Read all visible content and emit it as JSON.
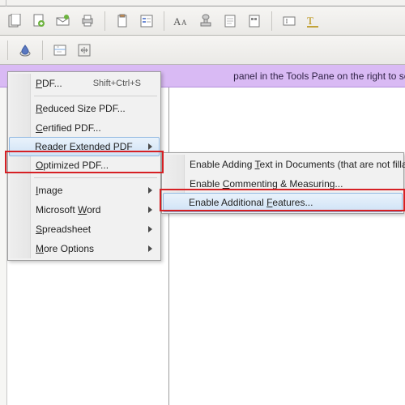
{
  "toolbar_row1_icons": [
    "pages-icon",
    "page-add-icon",
    "mail-pdf-icon",
    "print-icon",
    "clipboard-icon",
    "forms-icon",
    "text-size-icon",
    "stamp-icon",
    "pageview-icon",
    "highlight-block-icon",
    "text-field-icon",
    "typewriter-icon"
  ],
  "toolbar_row2_icons": [
    "ink-icon",
    "scan-icon",
    "fit-icon"
  ],
  "infobar": {
    "text": " panel in the Tools Pane on the right to send it to your recipients."
  },
  "menu": {
    "items": [
      {
        "label_html": "<u>P</u>DF...",
        "shortcut": "Shift+Ctrl+S",
        "arrow": false
      },
      "sep",
      {
        "label_html": "<u>R</u>educed Size PDF...",
        "arrow": false
      },
      {
        "label_html": "<u>C</u>ertified PDF...",
        "arrow": false
      },
      {
        "label_html": "Reader E<u>x</u>tended PDF",
        "arrow": true,
        "highlight": true
      },
      {
        "label_html": "<u>O</u>ptimized PDF...",
        "arrow": false
      },
      "sep",
      {
        "label_html": "<u>I</u>mage",
        "arrow": true
      },
      {
        "label_html": "Microsoft <u>W</u>ord",
        "arrow": true
      },
      {
        "label_html": "<u>S</u>preadsheet",
        "arrow": true
      },
      {
        "label_html": "<u>M</u>ore Options",
        "arrow": true
      }
    ]
  },
  "submenu": {
    "items": [
      {
        "label_html": "Enable Adding <u>T</u>ext in Documents (that are not fillable forms)..."
      },
      {
        "label_html": "Enable <u>C</u>ommenting & Measuring..."
      },
      {
        "label_html": "Enable Additional <u>F</u>eatures...",
        "highlight": true
      }
    ]
  }
}
